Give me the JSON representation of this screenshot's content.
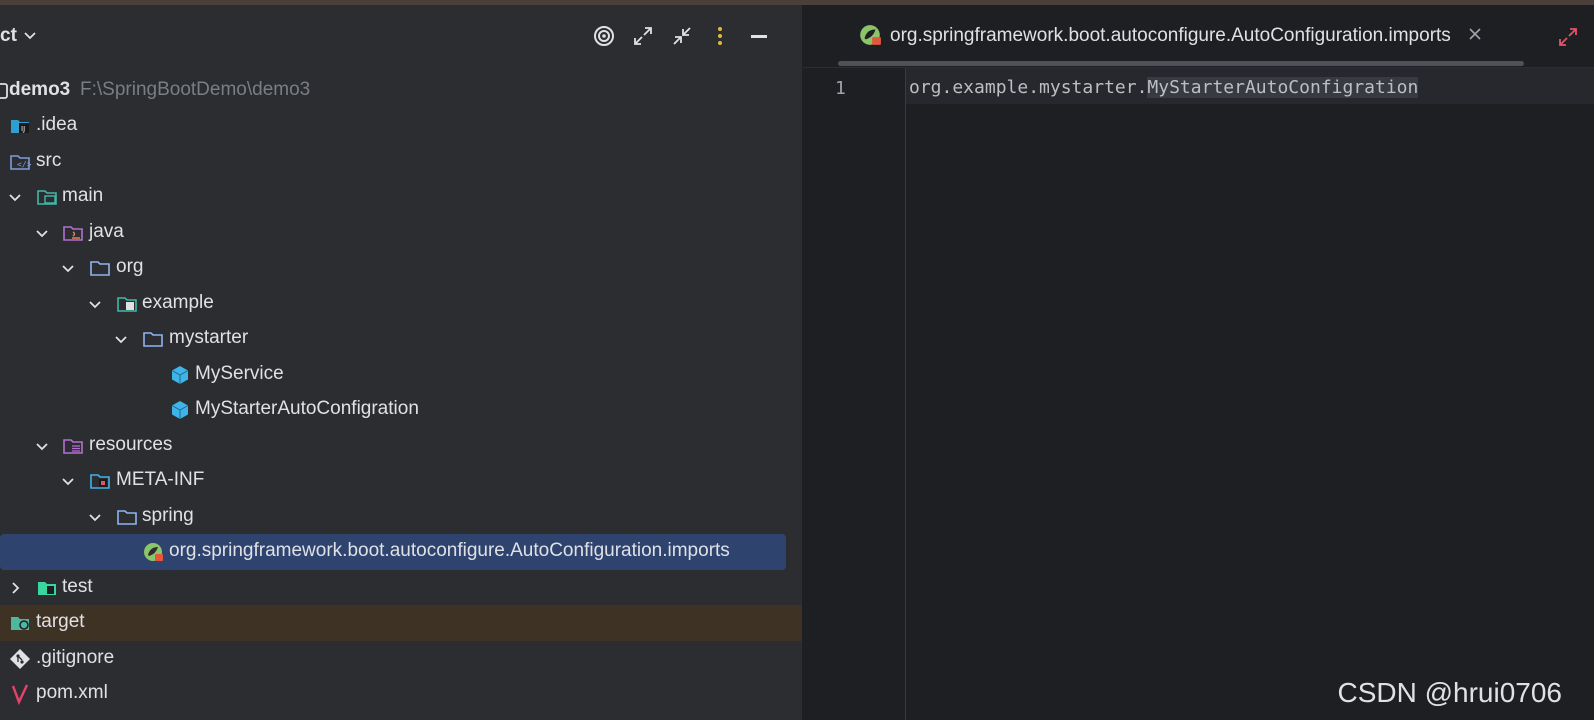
{
  "project_panel": {
    "title": "ct",
    "toolbar": {
      "locate_icon": "target-icon",
      "expand_icon": "expand-all-icon",
      "collapse_icon": "collapse-all-icon",
      "options_icon": "more-vertical-icon",
      "hide_icon": "minimize-icon"
    },
    "tree": [
      {
        "label": "demo3",
        "path": "F:\\SpringBootDemo\\demo3",
        "icon": "module-icon"
      },
      {
        "label": ".idea",
        "icon": "idea-folder-icon"
      },
      {
        "label": "src",
        "icon": "source-folder-icon"
      },
      {
        "label": "main",
        "icon": "main-folder-icon",
        "expanded": true
      },
      {
        "label": "java",
        "icon": "java-source-root-icon",
        "expanded": true
      },
      {
        "label": "org",
        "icon": "package-folder-icon",
        "expanded": true
      },
      {
        "label": "example",
        "icon": "package-folder-icon",
        "expanded": true
      },
      {
        "label": "mystarter",
        "icon": "package-folder-icon",
        "expanded": true
      },
      {
        "label": "MyService",
        "icon": "java-class-icon"
      },
      {
        "label": "MyStarterAutoConfigration",
        "icon": "java-class-icon"
      },
      {
        "label": "resources",
        "icon": "resources-root-icon",
        "expanded": true
      },
      {
        "label": "META-INF",
        "icon": "meta-inf-folder-icon",
        "expanded": true
      },
      {
        "label": "spring",
        "icon": "folder-icon",
        "expanded": true
      },
      {
        "label": "org.springframework.boot.autoconfigure.AutoConfiguration.imports",
        "icon": "spring-file-icon",
        "selected": true
      },
      {
        "label": "test",
        "icon": "test-folder-icon",
        "expanded": false
      },
      {
        "label": "target",
        "icon": "excluded-folder-icon"
      },
      {
        "label": ".gitignore",
        "icon": "git-icon"
      },
      {
        "label": "pom.xml",
        "icon": "maven-icon"
      }
    ]
  },
  "editor": {
    "tab": {
      "label": "org.springframework.boot.autoconfigure.AutoConfiguration.imports",
      "icon": "spring-file-icon",
      "close_label": "×"
    },
    "lines": [
      {
        "number": "1",
        "prefix": "org.example.mystarter.",
        "highlight": "MyStarterAutoConfigration"
      }
    ]
  },
  "watermark": "CSDN @hrui0706",
  "colors": {
    "panel_bg": "#2b2d30",
    "editor_bg": "#1e1f22",
    "selection": "#2e436e",
    "excluded_row": "#3d3223",
    "folder_blue": "#548af7",
    "class_blue": "#3592c4"
  }
}
